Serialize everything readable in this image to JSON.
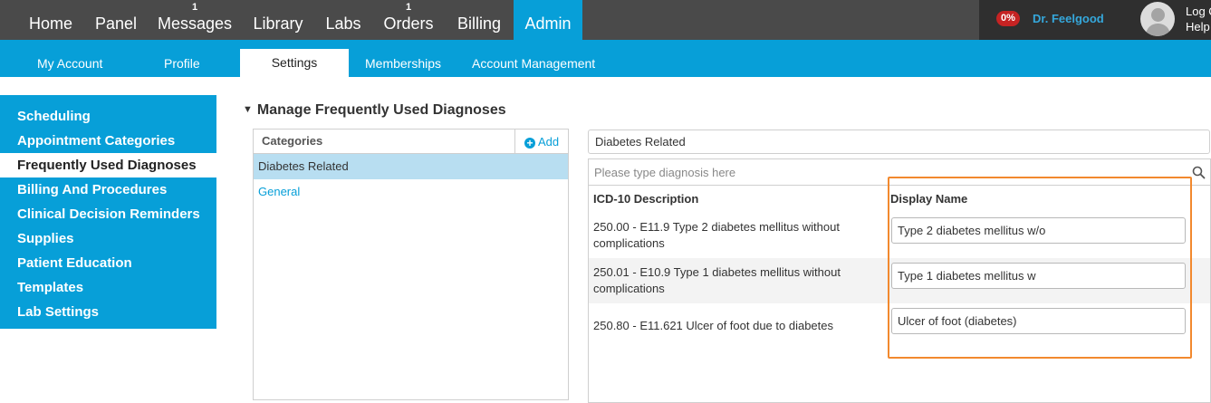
{
  "topnav": {
    "items": [
      {
        "label": "Home",
        "badge": ""
      },
      {
        "label": "Panel",
        "badge": ""
      },
      {
        "label": "Messages",
        "badge": "1"
      },
      {
        "label": "Library",
        "badge": ""
      },
      {
        "label": "Labs",
        "badge": ""
      },
      {
        "label": "Orders",
        "badge": "1"
      },
      {
        "label": "Billing",
        "badge": ""
      },
      {
        "label": "Admin",
        "badge": ""
      }
    ],
    "active": "Admin"
  },
  "user": {
    "percent": "0%",
    "name": "Dr. Feelgood",
    "log_label": "Log O",
    "help_label": "Help"
  },
  "subnav": {
    "items": [
      "My Account",
      "Profile",
      "Settings",
      "Memberships",
      "Account Management"
    ],
    "active": "Settings"
  },
  "sidebar": {
    "items": [
      "Scheduling",
      "Appointment Categories",
      "Frequently Used Diagnoses",
      "Billing And Procedures",
      "Clinical Decision Reminders",
      "Supplies",
      "Patient Education",
      "Templates",
      "Lab Settings"
    ],
    "active": "Frequently Used Diagnoses"
  },
  "section": {
    "title": "Manage Frequently Used Diagnoses"
  },
  "categories": {
    "header": "Categories",
    "add_label": "Add",
    "items": [
      "Diabetes Related",
      "General"
    ],
    "selected": "Diabetes Related"
  },
  "diagnoses": {
    "category_name": "Diabetes Related",
    "search_placeholder": "Please type diagnosis here",
    "col_description": "ICD-10 Description",
    "col_display": "Display Name",
    "rows": [
      {
        "description": "250.00 - E11.9 Type 2 diabetes mellitus without complications",
        "display_name": "Type 2 diabetes mellitus w/o"
      },
      {
        "description": "250.01 - E10.9 Type 1 diabetes mellitus without complications",
        "display_name": "Type 1 diabetes mellitus w"
      },
      {
        "description": "250.80 - E11.621 Ulcer of foot due to diabetes",
        "display_name": "Ulcer of foot (diabetes)"
      }
    ]
  },
  "colors": {
    "accent": "#079fd8",
    "nav_dark": "#4a4a4a",
    "highlight": "#f2892e",
    "badge_red": "#c52323"
  }
}
